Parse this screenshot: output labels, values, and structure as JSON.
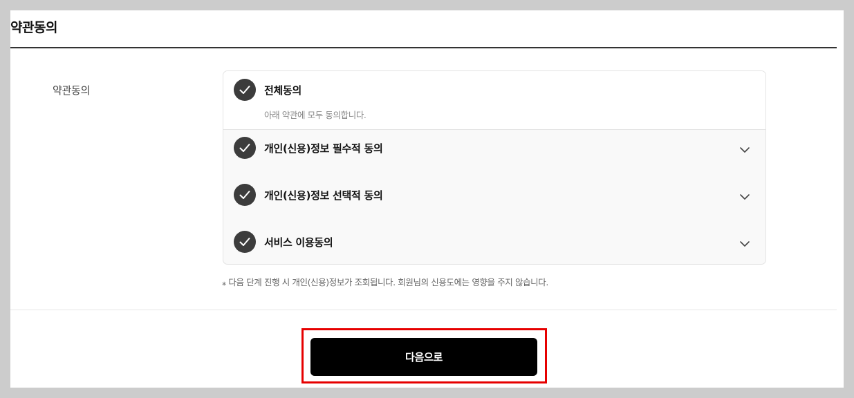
{
  "section": {
    "title": "약관동의",
    "row_label": "약관동의"
  },
  "all_agree": {
    "checked": true,
    "label": "전체동의",
    "description": "아래 약관에 모두 동의합니다."
  },
  "terms": [
    {
      "label": "개인(신용)정보 필수적 동의",
      "checked": true,
      "icon": "chevron-down-icon"
    },
    {
      "label": "개인(신용)정보 선택적 동의",
      "checked": true,
      "icon": "chevron-down-icon"
    },
    {
      "label": "서비스 이용동의",
      "checked": true,
      "icon": "chevron-down-icon"
    }
  ],
  "notice": "⁎ 다음 단계 진행 시 개인(신용)정보가 조회됩니다. 회원님의 신용도에는 영향을 주지 않습니다.",
  "next_button": {
    "label": "다음으로"
  },
  "colors": {
    "check_fill": "#3c3c3c",
    "button_bg": "#000000",
    "highlight_border": "#e60000"
  }
}
